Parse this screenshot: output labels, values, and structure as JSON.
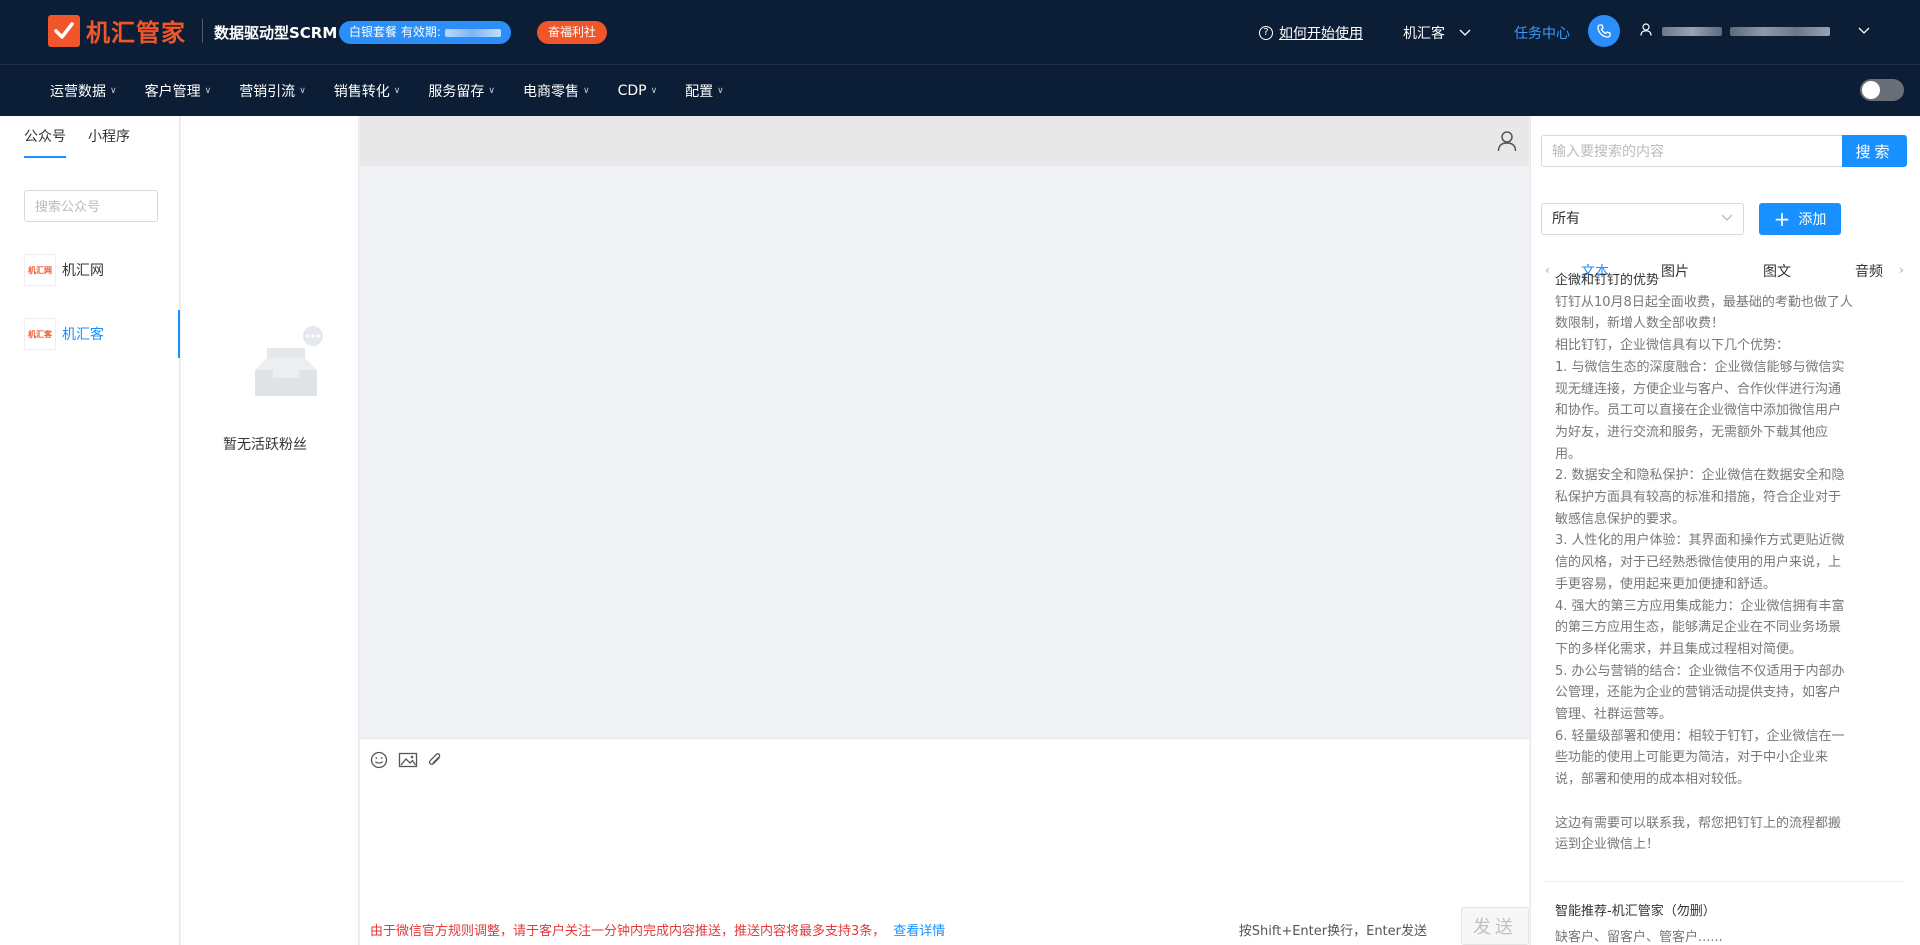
{
  "header": {
    "brand": "机汇管家",
    "slogan": "数据驱动型SCRM",
    "plan": "白银套餐 有效期:",
    "welfare": "奋福利社",
    "help": "如何开始使用",
    "org": "机汇客",
    "task_center": "任务中心"
  },
  "nav": {
    "items": [
      {
        "label": "运营数据"
      },
      {
        "label": "客户管理"
      },
      {
        "label": "营销引流"
      },
      {
        "label": "销售转化"
      },
      {
        "label": "服务留存"
      },
      {
        "label": "电商零售"
      },
      {
        "label": "CDP"
      },
      {
        "label": "配置"
      }
    ]
  },
  "accounts": {
    "tabs": [
      "公众号",
      "小程序"
    ],
    "search_placeholder": "搜索公众号",
    "items": [
      {
        "name": "机汇网",
        "avatar_text": "机汇网"
      },
      {
        "name": "机汇客",
        "avatar_text": "机汇客"
      }
    ]
  },
  "fans": {
    "empty_text": "暂无活跃粉丝"
  },
  "composer": {
    "notice": "由于微信官方规则调整，请于客户关注一分钟内完成内容推送，推送内容将最多支持3条，",
    "notice_link": "查看详情",
    "hint": "按Shift+Enter换行，Enter发送",
    "send_label": "发送"
  },
  "materials": {
    "search_placeholder": "输入要搜索的内容",
    "search_label": "搜索",
    "filter_value": "所有",
    "add_label": "添加",
    "tabs": [
      "文本",
      "图片",
      "图文",
      "音频"
    ],
    "article_title": "企微和钉钉的优势",
    "article_lines": [
      "钉钉从10月8日起全面收费，最基础的考勤也做了人",
      "数限制，新增人数全部收费！",
      "相比钉钉，企业微信具有以下几个优势：",
      "1. 与微信生态的深度融合：企业微信能够与微信实",
      "现无缝连接，方便企业与客户、合作伙伴进行沟通",
      "和协作。员工可以直接在企业微信中添加微信用户",
      "为好友，进行交流和服务，无需额外下载其他应",
      "用。",
      "2. 数据安全和隐私保护：企业微信在数据安全和隐",
      "私保护方面具有较高的标准和措施，符合企业对于",
      "敏感信息保护的要求。",
      "3. 人性化的用户体验：其界面和操作方式更贴近微",
      "信的风格，对于已经熟悉微信使用的用户来说，上",
      "手更容易，使用起来更加便捷和舒适。",
      "4. 强大的第三方应用集成能力：企业微信拥有丰富",
      "的第三方应用生态，能够满足企业在不同业务场景",
      "下的多样化需求，并且集成过程相对简便。",
      "5. 办公与营销的结合：企业微信不仅适用于内部办",
      "公管理，还能为企业的营销活动提供支持，如客户",
      "管理、社群运营等。",
      "6. 轻量级部署和使用：相较于钉钉，企业微信在一",
      "些功能的使用上可能更为简洁，对于中小企业来",
      "说，部署和使用的成本相对较低。",
      "",
      "这边有需要可以联系我，帮您把钉钉上的流程都搬",
      "运到企业微信上！"
    ],
    "rec_title": "智能推荐-机汇管家（勿删）",
    "rec_desc": "缺客户、留客户、管客户......"
  },
  "colors": {
    "header_bg": "#0c1e35",
    "brand": "#f0562a",
    "accent": "#1890ff",
    "notice": "#e23a3a"
  }
}
